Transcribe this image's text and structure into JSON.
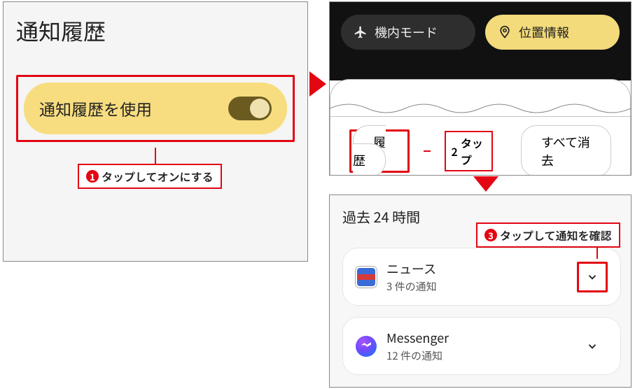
{
  "left": {
    "title": "通知履歴",
    "toggle_label": "通知履歴を使用"
  },
  "callouts": {
    "c1": "タップしてオンにする",
    "c2": "タップ",
    "c3": "タップして通知を確認"
  },
  "quick_settings": {
    "airplane": "機内モード",
    "location": "位置情報"
  },
  "sheet": {
    "history_btn": "履歴",
    "clear_btn": "すべて消去"
  },
  "history": {
    "title": "過去 24 時間",
    "items": [
      {
        "name": "ニュース",
        "sub": "3 件の通知"
      },
      {
        "name": "Messenger",
        "sub": "12 件の通知"
      }
    ]
  }
}
